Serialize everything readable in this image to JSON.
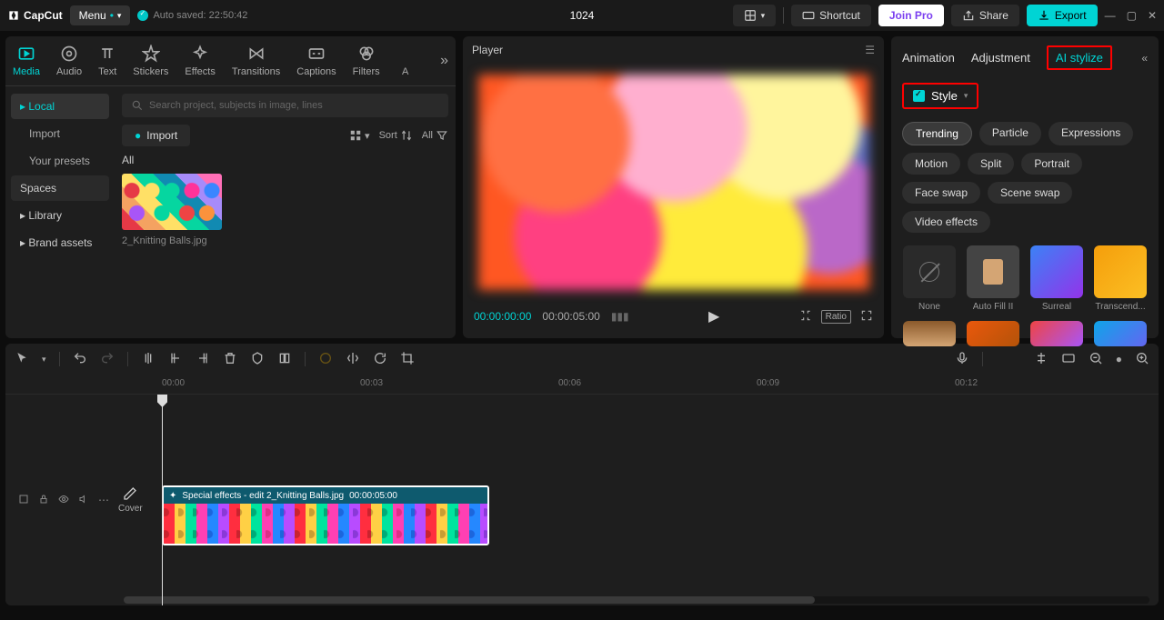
{
  "titlebar": {
    "logo": "CapCut",
    "menu": "Menu",
    "autosave": "Auto saved: 22:50:42",
    "project_title": "1024",
    "shortcut": "Shortcut",
    "join_pro": "Join Pro",
    "share": "Share",
    "export": "Export"
  },
  "toolbar_tabs": {
    "media": "Media",
    "audio": "Audio",
    "text": "Text",
    "stickers": "Stickers",
    "effects": "Effects",
    "transitions": "Transitions",
    "captions": "Captions",
    "filters": "Filters",
    "a_partial": "A"
  },
  "sidebar": {
    "local": "Local",
    "import": "Import",
    "your_presets": "Your presets",
    "spaces": "Spaces",
    "library": "Library",
    "brand_assets": "Brand assets"
  },
  "media": {
    "search_placeholder": "Search project, subjects in image, lines",
    "import_btn": "Import",
    "sort": "Sort",
    "all_filter": "All",
    "all_label": "All",
    "thumb_name": "2_Knitting Balls.jpg"
  },
  "player": {
    "title": "Player",
    "time_current": "00:00:00:00",
    "time_duration": "00:00:05:00",
    "ratio": "Ratio"
  },
  "right_panel": {
    "tabs": {
      "animation": "Animation",
      "adjustment": "Adjustment",
      "ai_stylize": "AI stylize"
    },
    "style_title": "Style",
    "chips": {
      "trending": "Trending",
      "particle": "Particle",
      "expressions": "Expressions",
      "motion": "Motion",
      "split": "Split",
      "portrait": "Portrait",
      "face_swap": "Face swap",
      "scene_swap": "Scene swap",
      "video_effects": "Video effects"
    },
    "styles": {
      "none": "None",
      "autofill": "Auto Fill II",
      "surreal": "Surreal",
      "transcend": "Transcend..."
    }
  },
  "timeline": {
    "ticks": [
      "00:00",
      "00:03",
      "00:06",
      "00:09",
      "00:12"
    ],
    "cover": "Cover",
    "clip_label": "Special effects - edit  2_Knitting Balls.jpg",
    "clip_duration": "00:00:05:00"
  }
}
